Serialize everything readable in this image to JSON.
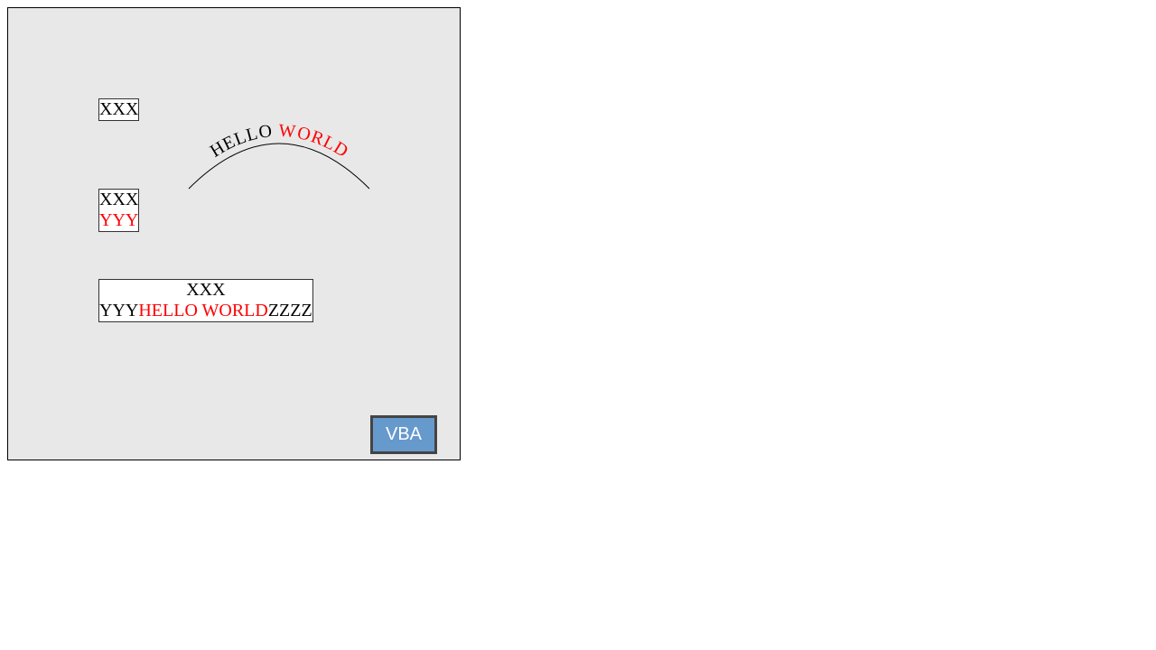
{
  "textbox_single": {
    "line1": "XXX"
  },
  "textbox_two_line": {
    "line1": "XXX",
    "line2": "YYY"
  },
  "textbox_mixed": {
    "line1": "XXX",
    "line2_prefix": "YYY",
    "line2_highlight": "HELLO WORLD",
    "line2_suffix": "ZZZZ"
  },
  "arc_text": {
    "part1": "HELLO ",
    "part2": "WORLD"
  },
  "vba_button": {
    "label": "VBA"
  },
  "colors": {
    "canvas_bg": "#e8e8e8",
    "highlight": "#ff0000",
    "button_bg": "#6699cc",
    "button_border": "#444444"
  }
}
